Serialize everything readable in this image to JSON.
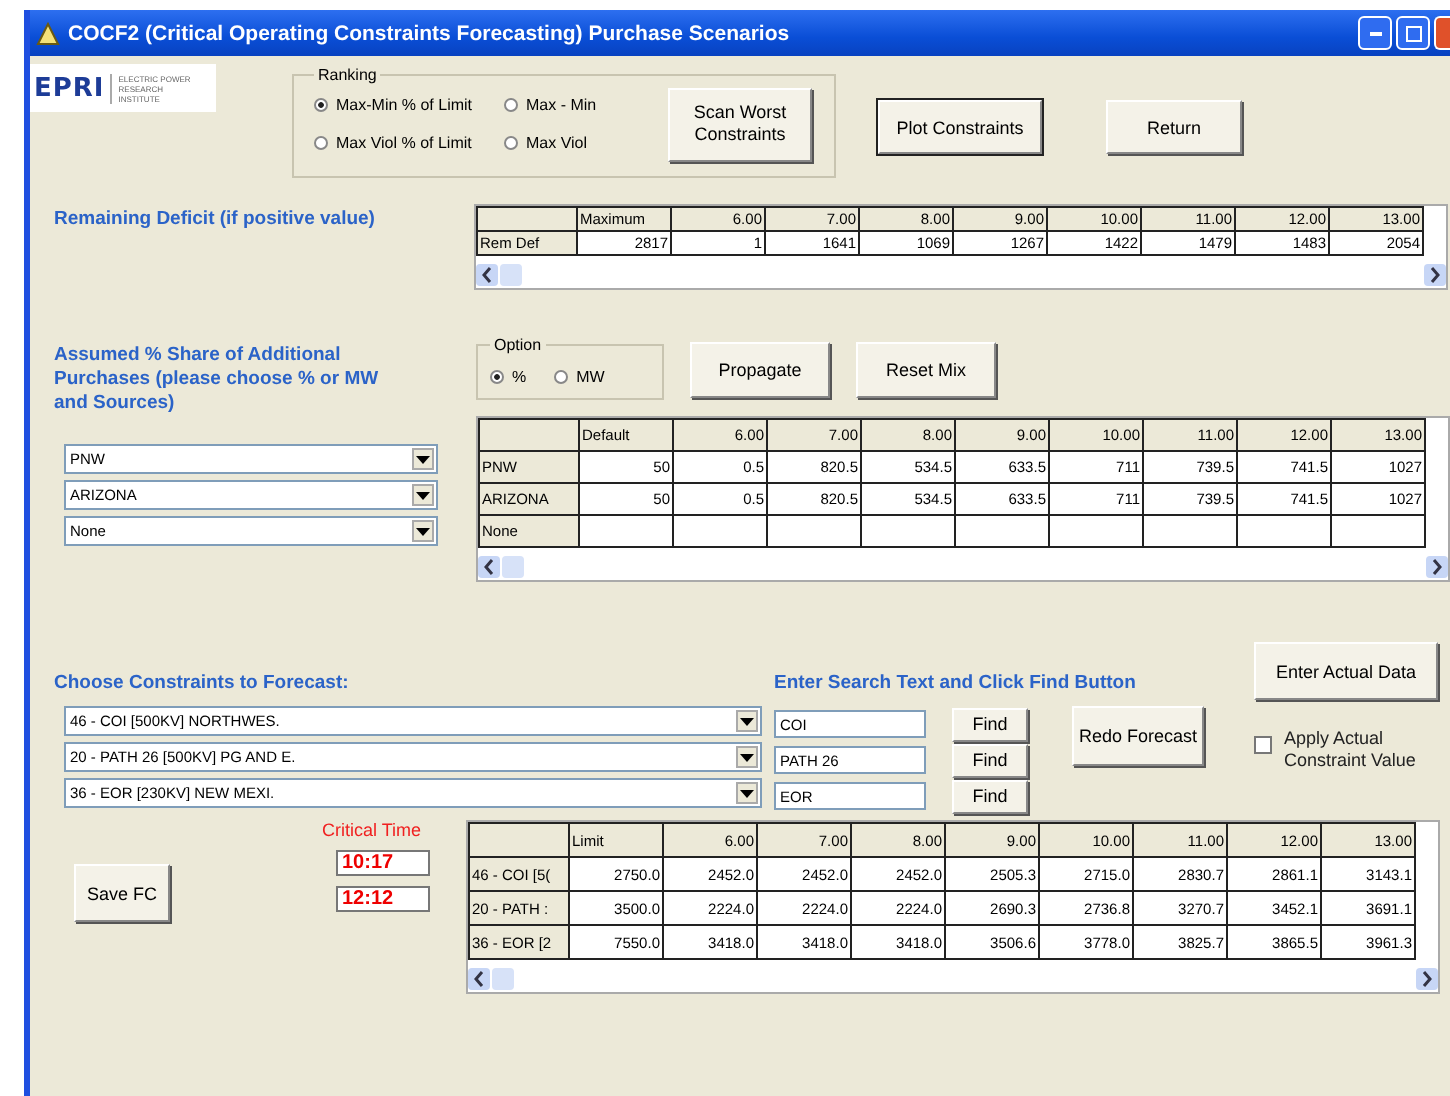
{
  "window": {
    "title": "COCF2 (Critical Operating Constraints Forecasting) Purchase Scenarios"
  },
  "logo": {
    "mark": "EPRI",
    "subtitle": "ELECTRIC POWER RESEARCH INSTITUTE"
  },
  "ranking": {
    "label": "Ranking",
    "options": [
      {
        "label": "Max-Min % of Limit",
        "selected": true
      },
      {
        "label": "Max - Min",
        "selected": false
      },
      {
        "label": "Max Viol % of Limit",
        "selected": false
      },
      {
        "label": "Max Viol",
        "selected": false
      }
    ]
  },
  "top_buttons": [
    {
      "label": "Scan Worst Constraints",
      "default": false
    },
    {
      "label": "Plot Constraints",
      "default": true
    },
    {
      "label": "Return",
      "default": false
    }
  ],
  "deficit": {
    "label": "Remaining Deficit (if positive value)",
    "columns": [
      "Maximum",
      "6.00",
      "7.00",
      "8.00",
      "9.00",
      "10.00",
      "11.00",
      "12.00",
      "13.00"
    ],
    "rows": [
      {
        "header": "Rem Def",
        "cells": [
          "2817",
          "1",
          "1641",
          "1069",
          "1267",
          "1422",
          "1479",
          "1483",
          "2054"
        ]
      }
    ]
  },
  "share": {
    "label": "Assumed % Share of Additional Purchases (please choose % or MW and Sources)",
    "option": {
      "label": "Option",
      "choices": [
        {
          "label": "%",
          "selected": true
        },
        {
          "label": "MW",
          "selected": false
        }
      ]
    },
    "buttons": [
      "Propagate",
      "Reset Mix"
    ],
    "sources": [
      "PNW",
      "ARIZONA",
      "None"
    ],
    "columns": [
      "Default",
      "6.00",
      "7.00",
      "8.00",
      "9.00",
      "10.00",
      "11.00",
      "12.00",
      "13.00"
    ],
    "rows": [
      {
        "header": "PNW",
        "cells": [
          "50",
          "0.5",
          "820.5",
          "534.5",
          "633.5",
          "711",
          "739.5",
          "741.5",
          "1027"
        ]
      },
      {
        "header": "ARIZONA",
        "cells": [
          "50",
          "0.5",
          "820.5",
          "534.5",
          "633.5",
          "711",
          "739.5",
          "741.5",
          "1027"
        ]
      },
      {
        "header": "None",
        "cells": [
          "",
          "",
          "",
          "",
          "",
          "",
          "",
          "",
          ""
        ]
      }
    ]
  },
  "constraints": {
    "label": "Choose Constraints to Forecast:",
    "search_label": "Enter Search Text and Click Find Button",
    "items": [
      {
        "constraint": "46 - COI [500KV] NORTHWES.",
        "search": "COI",
        "button": "Find"
      },
      {
        "constraint": "20 - PATH 26 [500KV] PG AND E.",
        "search": "PATH 26",
        "button": "Find"
      },
      {
        "constraint": "36 - EOR [230KV] NEW MEXI.",
        "search": "EOR",
        "button": "Find"
      }
    ],
    "redo_button": "Redo Forecast",
    "actual_button": "Enter Actual Data",
    "apply": {
      "label": "Apply Actual Constraint Value",
      "checked": false
    }
  },
  "forecast": {
    "critical_label": "Critical Time",
    "times": [
      "10:17",
      "12:12"
    ],
    "save_button": "Save FC",
    "columns": [
      "Limit",
      "6.00",
      "7.00",
      "8.00",
      "9.00",
      "10.00",
      "11.00",
      "12.00",
      "13.00"
    ],
    "rows": [
      {
        "header": "46 - COI [5(",
        "cells": [
          "2750.0",
          "2452.0",
          "2452.0",
          "2452.0",
          "2505.3",
          "2715.0",
          "2830.7",
          "2861.1",
          "3143.1"
        ]
      },
      {
        "header": "20 - PATH :",
        "cells": [
          "3500.0",
          "2224.0",
          "2224.0",
          "2224.0",
          "2690.3",
          "2736.8",
          "3270.7",
          "3452.1",
          "3691.1"
        ]
      },
      {
        "header": "36 - EOR [2",
        "cells": [
          "7550.0",
          "3418.0",
          "3418.0",
          "3418.0",
          "3506.6",
          "3778.0",
          "3825.7",
          "3865.5",
          "3961.3"
        ]
      }
    ]
  }
}
